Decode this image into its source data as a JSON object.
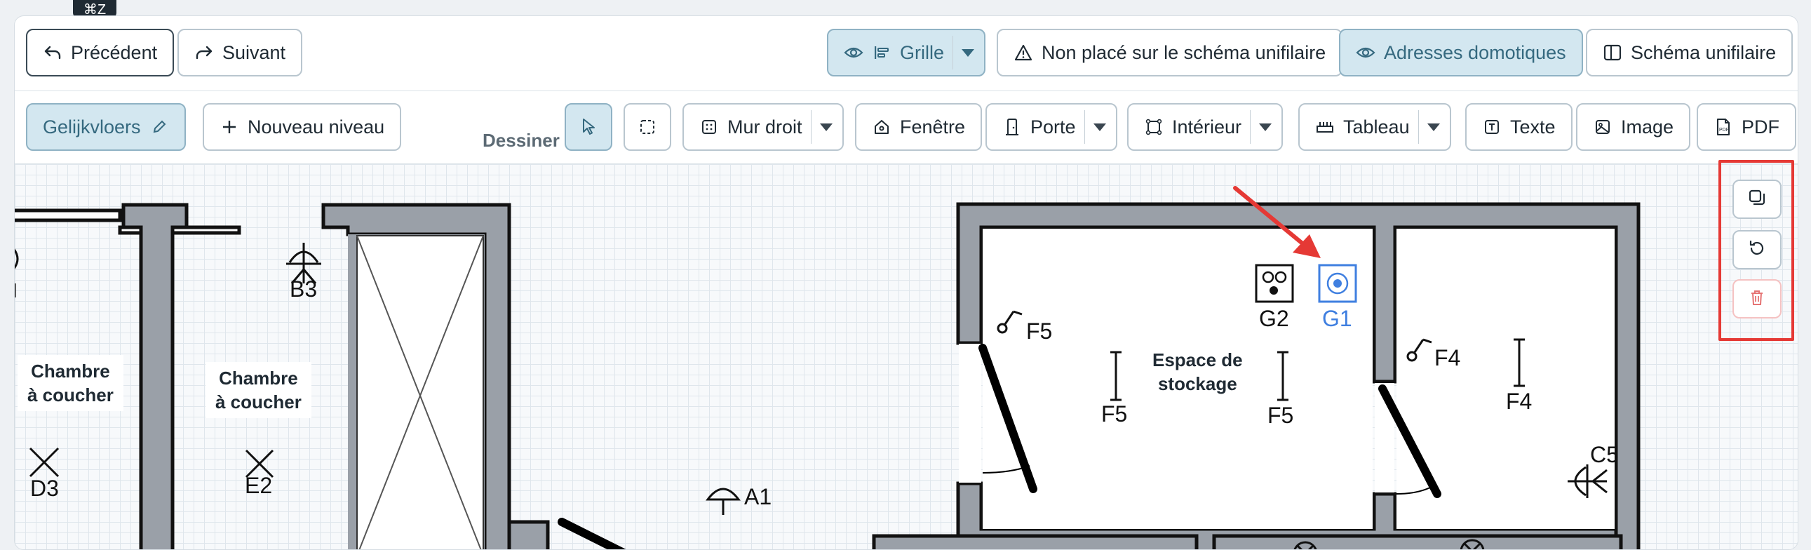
{
  "tooltip": "⌘Z",
  "toolbar": {
    "previous_label": "Précédent",
    "next_label": "Suivant",
    "grid_label": "Grille",
    "not_placed_label": "Non placé sur le schéma unifilaire",
    "home_addresses_label": "Adresses domotiques",
    "single_line_label": "Schéma unifilaire"
  },
  "draw_bar": {
    "level_name": "Gelijkvloers",
    "new_level_label": "Nouveau niveau",
    "draw_label": "Dessiner :",
    "straight_wall_label": "Mur droit",
    "window_label": "Fenêtre",
    "door_label": "Porte",
    "interior_label": "Intérieur",
    "panel_label": "Tableau",
    "text_label": "Texte",
    "image_label": "Image",
    "pdf_label": "PDF"
  },
  "plan": {
    "rooms": [
      {
        "line1": "Chambre",
        "line2": "à coucher"
      },
      {
        "line1": "Chambre",
        "line2": "à coucher"
      },
      {
        "line1": "Espace de",
        "line2": "stockage"
      }
    ],
    "symbols": {
      "b3": "B3",
      "d3": "D3",
      "e2": "E2",
      "a1": "A1",
      "f5_a": "F5",
      "f5_b": "F5",
      "f5_c": "F5",
      "g2": "G2",
      "g1": "G1",
      "f4_a": "F4",
      "f4_b": "F4",
      "c5": "C5"
    }
  },
  "controls": {
    "duplicate": "duplicate-icon",
    "rotate": "rotate-icon",
    "delete": "trash-icon"
  },
  "colors": {
    "accent": "#35697f",
    "active_bg": "#d3e7f0",
    "selected_symbol": "#3f7fe0",
    "highlight_box": "#e53935",
    "arrow": "#e53935",
    "wall": "#9aa0a8"
  }
}
